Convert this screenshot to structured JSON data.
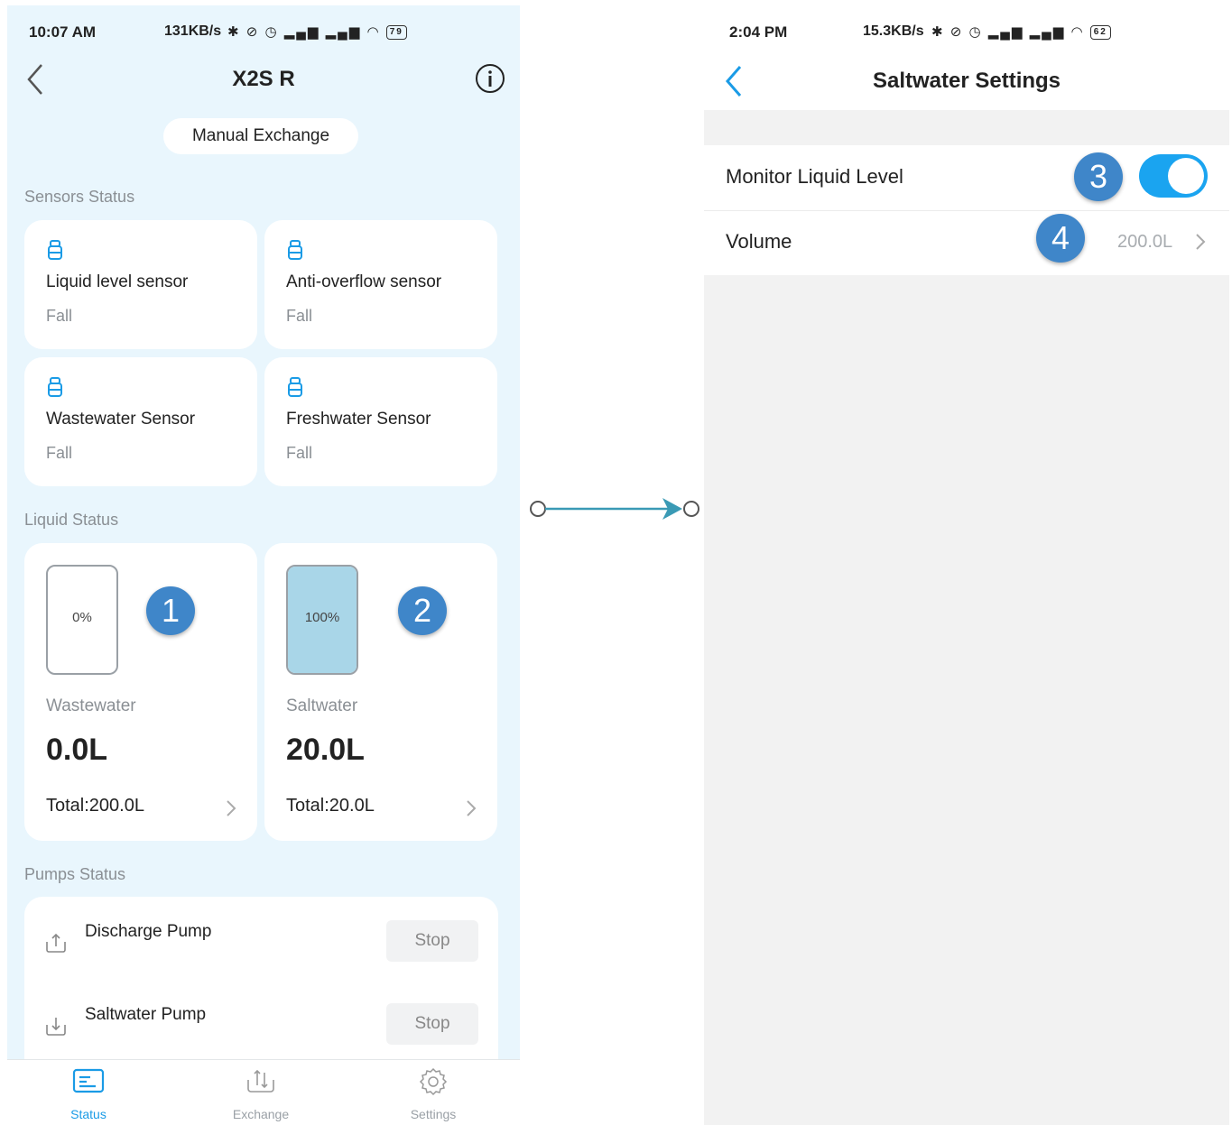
{
  "left_screen": {
    "status_bar": {
      "time": "10:07 AM",
      "network_speed": "131KB/s",
      "icons": "✱ ⊘ ◷ ▂▄▆ ▂▄▆ ◠",
      "battery": "79"
    },
    "title": "X2S R",
    "manual_exchange": "Manual Exchange",
    "sensors_label": "Sensors Status",
    "sensors": [
      {
        "name": "Liquid level sensor",
        "value": "Fall"
      },
      {
        "name": "Anti-overflow sensor",
        "value": "Fall"
      },
      {
        "name": "Wastewater Sensor",
        "value": "Fall"
      },
      {
        "name": "Freshwater Sensor",
        "value": "Fall"
      }
    ],
    "liquid_label": "Liquid Status",
    "liquids": [
      {
        "percent_label": "0%",
        "fill_fraction": 0,
        "name": "Wastewater",
        "amount": "0.0L",
        "total": "Total:200.0L",
        "badge": "1"
      },
      {
        "percent_label": "100%",
        "fill_fraction": 1,
        "name": "Saltwater",
        "amount": "20.0L",
        "total": "Total:20.0L",
        "badge": "2"
      }
    ],
    "pumps_label": "Pumps Status",
    "pumps": [
      {
        "name": "Discharge Pump",
        "button": "Stop"
      },
      {
        "name": "Saltwater Pump",
        "button": "Stop"
      }
    ],
    "tabs": [
      {
        "label": "Status",
        "active": true
      },
      {
        "label": "Exchange",
        "active": false
      },
      {
        "label": "Settings",
        "active": false
      }
    ],
    "colors": {
      "accent": "#1a9be6",
      "background": "#e9f6fd",
      "badge": "#3f86c9"
    }
  },
  "right_screen": {
    "status_bar": {
      "time": "2:04 PM",
      "network_speed": "15.3KB/s",
      "icons": "✱ ⊘ ◷ ▂▄▆ ▂▄▆ ◠",
      "battery": "62"
    },
    "title": "Saltwater Settings",
    "monitor_label": "Monitor Liquid Level",
    "monitor_enabled": true,
    "monitor_badge": "3",
    "volume_label": "Volume",
    "volume_value": "200.0L",
    "volume_badge": "4",
    "colors": {
      "toggle_on": "#1aa4f0"
    }
  }
}
